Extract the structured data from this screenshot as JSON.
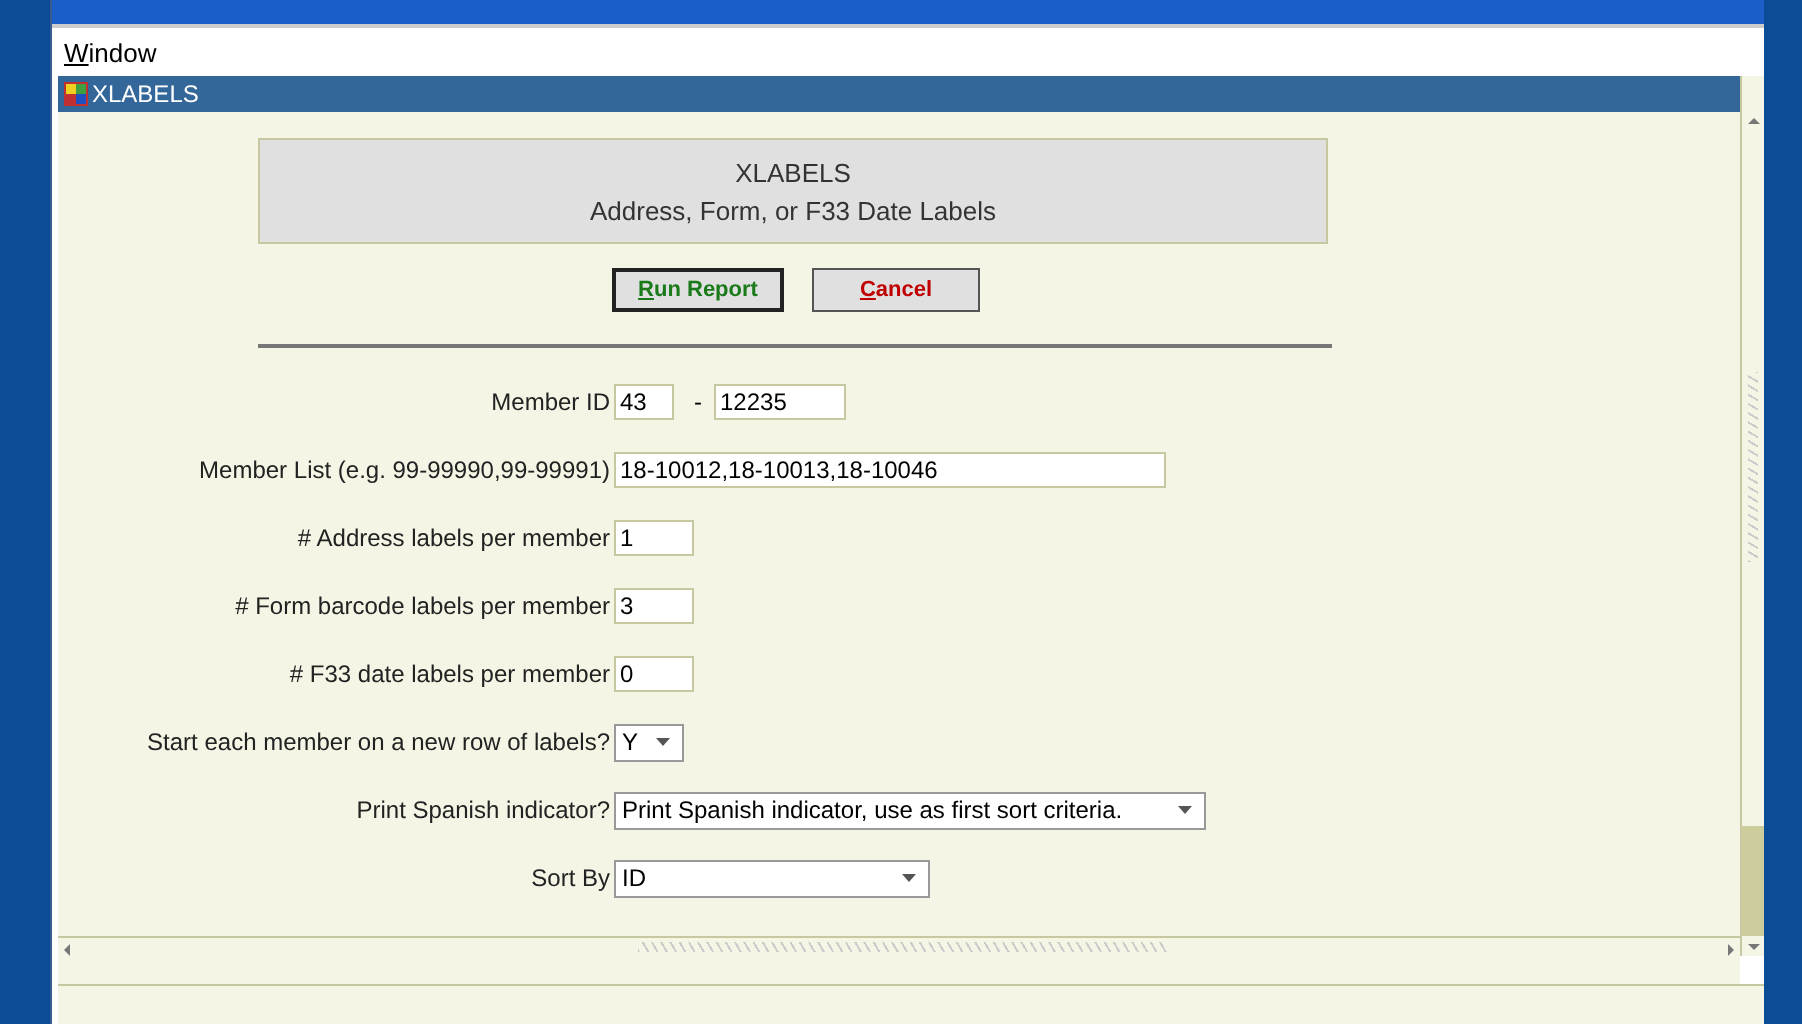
{
  "menu": [
    "Window"
  ],
  "frame": {
    "title": "XLABELS"
  },
  "header": {
    "title": "XLABELS",
    "subtitle": "Address, Form, or F33 Date Labels"
  },
  "buttons": [
    {
      "label": "Run Report",
      "kind": "primary"
    },
    {
      "label": "Cancel",
      "kind": "cancel"
    }
  ],
  "fields": [
    {
      "kind": "range",
      "label": "Member ID",
      "value": "43",
      "separator": "-",
      "value_to": "12235"
    },
    {
      "kind": "text",
      "label": "Member List (e.g. 99-99990,99-99991)",
      "value": "18-10012,18-10013,18-10046"
    },
    {
      "kind": "text",
      "label": "# Address labels per member",
      "value": "1"
    },
    {
      "kind": "text",
      "label": "# Form barcode labels per member",
      "value": "3"
    },
    {
      "kind": "text",
      "label": "# F33 date labels per member",
      "value": "0"
    },
    {
      "kind": "select",
      "label": "Start each member on a new row of labels?",
      "value": "Y"
    },
    {
      "kind": "select",
      "label": "Print Spanish indicator?",
      "value": "Print Spanish indicator, use as first sort criteria."
    },
    {
      "kind": "select",
      "label": "Sort By",
      "value": "ID"
    }
  ]
}
